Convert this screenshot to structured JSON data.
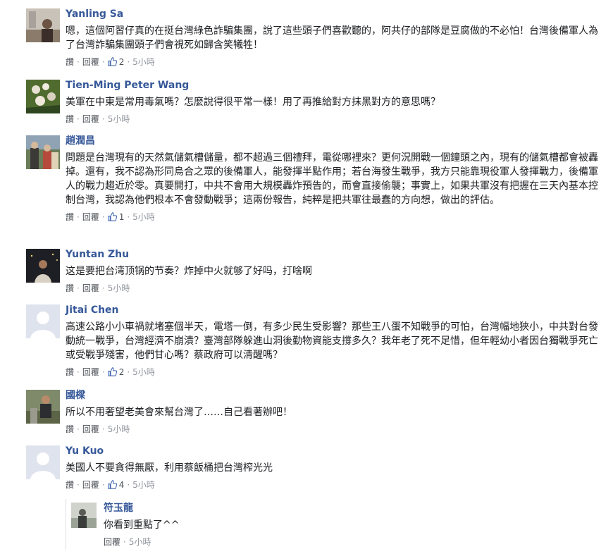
{
  "labels": {
    "reply": "回覆",
    "time_5h": "5小時",
    "thumb_icon": "thumbs-up-icon",
    "dot": "·"
  },
  "comments": [
    {
      "name": "Yanling Sa",
      "text": "嗯，這個阿習仔真的在挺台灣綠色詐騙集團，說了這些頭子們喜歡聽的，阿共仔的部隊是豆腐做的不必怕！台灣後備軍人為了台灣詐騙集團頭子們會視死如歸含笑犧牲！",
      "like_label": "讚",
      "reply_label": "回覆",
      "likes": "2",
      "time": "5小時"
    },
    {
      "name": "Tien-Ming Peter Wang",
      "text": "美軍在中東是常用毒氣嗎？怎麼說得很平常一樣！用了再推給對方抹黑對方的意思嗎？",
      "like_label": "讚",
      "reply_label": "回覆",
      "likes": "",
      "time": "5小時"
    },
    {
      "name": "趙潤昌",
      "text": "問題是台灣現有的天然氣儲氣槽儲量，都不超過三個禮拜，電從哪裡來？更何況開戰一個鐘頭之內，現有的儲氣槽都會被轟掉。還有，我不認為形同烏合之眾的後備軍人，能發揮半點作用；若台海發生戰爭，我方只能靠現役軍人發揮戰力，後備軍人的戰力趨近於零。真要開打，中共不會用大規模轟炸預告的，而會直接偷襲；事實上，如果共軍沒有把握在三天內基本控制台灣，我認為他們根本不會發動戰爭；這兩份報告，純粹是把共軍往最蠢的方向想，做出的評估。",
      "like_label": "讚",
      "reply_label": "回覆",
      "likes": "1",
      "time": "5小時"
    },
    {
      "name": "Yuntan Zhu",
      "text": "这是要把台湾顶锅的节奏？炸掉中火就够了好吗，打啥啊",
      "like_label": "讚",
      "reply_label": "回覆",
      "likes": "",
      "time": "5小時"
    },
    {
      "name": "Jitai Chen",
      "text": "高速公路小小車禍就堵塞個半天，電塔一倒，有多少民生受影響？那些王八蛋不知戰爭的可怕，台灣幅地狹小，中共對台發動統一戰爭，台灣經濟不崩潰？臺灣部隊躲進山洞後勤物資能支撐多久？我年老了死不足惜，但年輕幼小者因台獨戰爭死亡或受戰爭殘害，他們甘心嗎？蔡政府可以清醒嗎？",
      "like_label": "讚",
      "reply_label": "回覆",
      "likes": "2",
      "time": "5小時"
    },
    {
      "name": "國樑",
      "text": "所以不用奢望老美會來幫台灣了……自己看著辦吧！",
      "like_label": "讚",
      "reply_label": "回覆",
      "likes": "",
      "time": "5小時"
    },
    {
      "name": "Yu Kuo",
      "text": "美國人不要貪得無厭，利用蔡飯桶把台灣榨光光",
      "like_label": "讚",
      "reply_label": "回覆",
      "likes": "4",
      "time": "5小時"
    }
  ],
  "reply": {
    "name": "符玉龍",
    "text": "你看到重點了^^",
    "reply_label": "回覆",
    "time": "5小時"
  }
}
